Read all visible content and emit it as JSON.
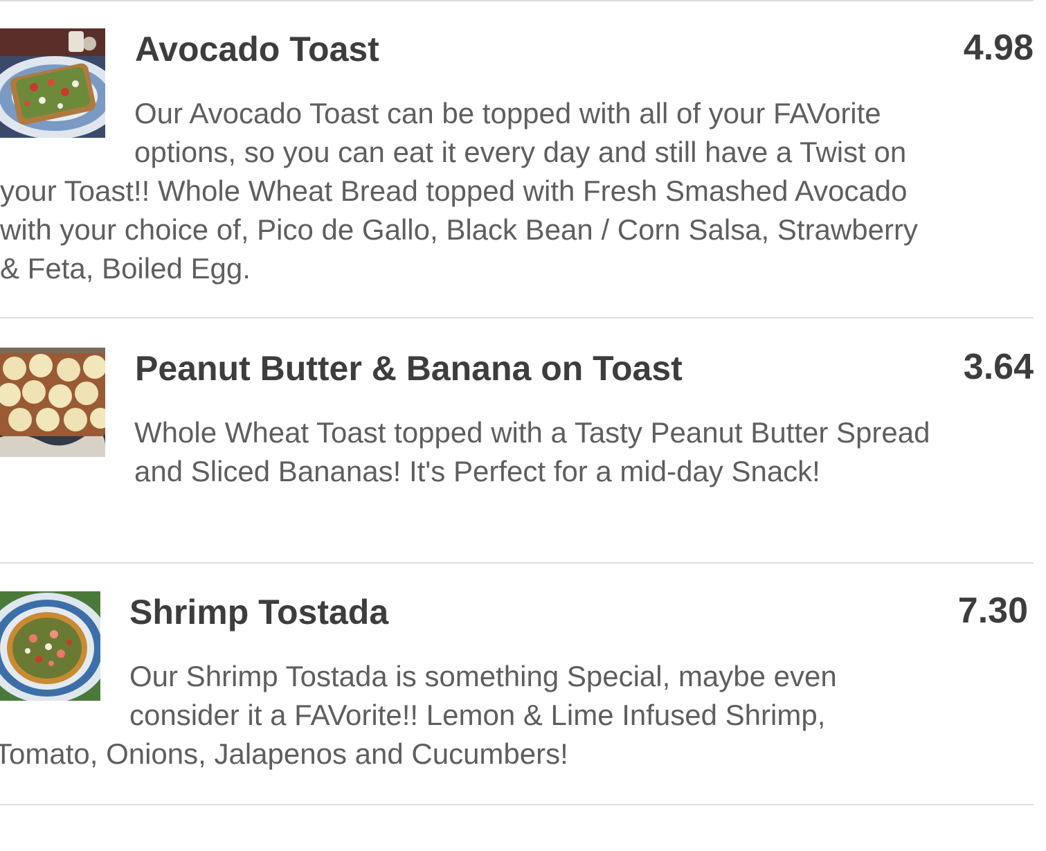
{
  "menu": {
    "items": [
      {
        "name": "Avocado Toast",
        "price": "4.98",
        "description": "Our Avocado Toast can be topped with all of your FAVorite options, so you can eat it every day and still have a Twist on your Toast!! Whole Wheat Bread topped with Fresh Smashed Avocado with your choice of, Pico de Gallo, Black Bean / Corn Salsa, Strawberry & Feta, Boiled Egg."
      },
      {
        "name": "Peanut Butter & Banana on Toast",
        "price": "3.64",
        "description": "Whole Wheat Toast topped with a Tasty Peanut Butter Spread and Sliced Bananas! It's Perfect for a mid-day Snack!"
      },
      {
        "name": "Shrimp Tostada",
        "price": "7.30",
        "description": "Our Shrimp Tostada is something Special, maybe even consider it a FAVorite!! Lemon & Lime Infused Shrimp, Tomato, Onions, Jalapenos and Cucumbers!"
      }
    ]
  },
  "colors": {
    "title_text": "#3d3d3d",
    "body_text": "#5e5e5e",
    "divider": "#dddddd"
  },
  "icons": {
    "item_1_photo": "avocado-toast-photo",
    "item_2_photo": "peanut-butter-banana-toast-photo",
    "item_3_photo": "shrimp-tostada-photo"
  }
}
